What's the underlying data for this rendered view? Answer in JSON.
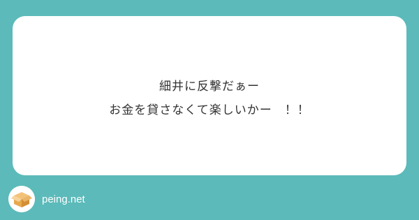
{
  "card": {
    "lines": [
      "細井に反撃だぁー",
      "お金を貸さなくて楽しいかー　！！"
    ]
  },
  "footer": {
    "logo_icon": "box-icon",
    "site_name": "peing.net"
  },
  "colors": {
    "background": "#5cbaba",
    "card": "#ffffff",
    "text": "#333333",
    "box": "#e8a94e"
  }
}
